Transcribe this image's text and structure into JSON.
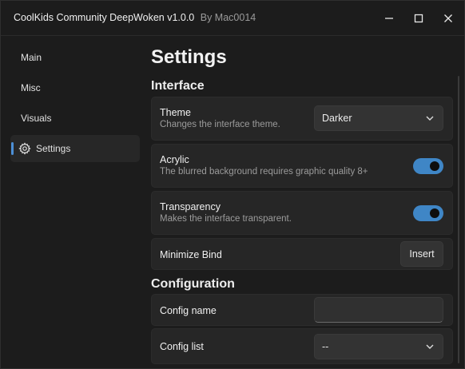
{
  "window": {
    "title": "CoolKids Community DeepWoken  v1.0.0",
    "author": "By Mac0014"
  },
  "sidebar": {
    "items": [
      {
        "label": "Main"
      },
      {
        "label": "Misc"
      },
      {
        "label": "Visuals"
      },
      {
        "label": "Settings",
        "icon": "gear-icon",
        "active": true
      }
    ]
  },
  "main": {
    "title": "Settings",
    "interface": {
      "heading": "Interface",
      "theme": {
        "label": "Theme",
        "desc": "Changes the interface theme.",
        "value": "Darker"
      },
      "acrylic": {
        "label": "Acrylic",
        "desc": "The blurred background requires graphic quality 8+",
        "enabled": true
      },
      "transparency": {
        "label": "Transparency",
        "desc": "Makes the interface transparent.",
        "enabled": true
      },
      "minimize_bind": {
        "label": "Minimize Bind",
        "value": "Insert"
      }
    },
    "configuration": {
      "heading": "Configuration",
      "config_name": {
        "label": "Config name",
        "value": ""
      },
      "config_list": {
        "label": "Config list",
        "value": "--"
      }
    }
  },
  "colors": {
    "accent": "#3f86c6",
    "indicator": "#4c8fd6",
    "background": "#1c1c1c",
    "card": "#262626"
  }
}
